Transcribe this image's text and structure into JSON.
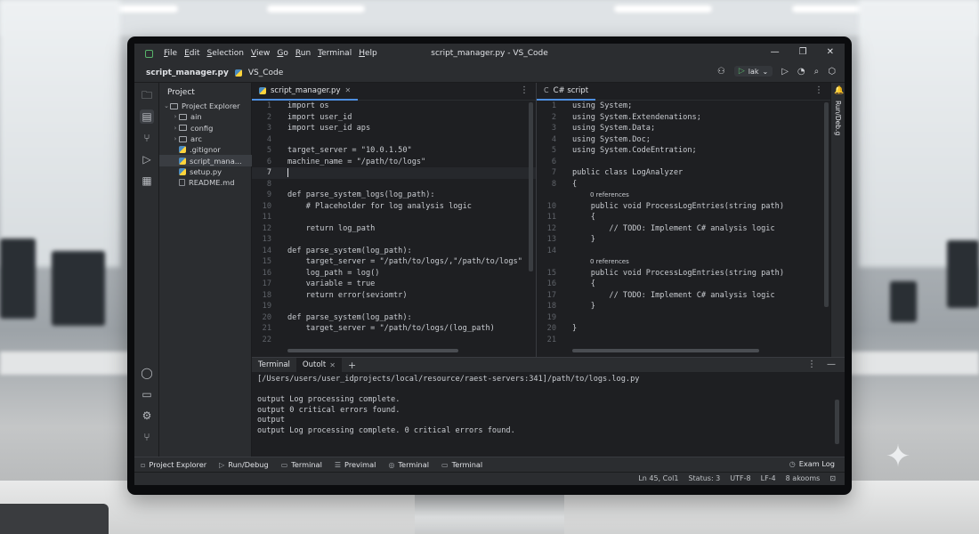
{
  "window": {
    "title": "script_manager.py - VS_Code",
    "menu": [
      "File",
      "Edit",
      "Selection",
      "View",
      "Go",
      "Run",
      "Terminal",
      "Help"
    ],
    "controls": [
      "—",
      "❐",
      "✕"
    ]
  },
  "toolbar": {
    "file": "script_manager.py",
    "project": "VS_Code",
    "run_config": "lak",
    "icons": [
      "account-icon",
      "play-icon",
      "debug-icon",
      "search-icon",
      "settings-icon"
    ]
  },
  "activity_bar": {
    "icons": [
      "folder-icon",
      "explorer-icon",
      "source-control-icon",
      "run-debug-icon",
      "extensions-icon",
      "account-icon",
      "terminal-icon",
      "settings-icon",
      "git-icon"
    ]
  },
  "explorer": {
    "panel_title": "Project",
    "items": [
      {
        "label": "Project Explorer",
        "kind": "folder",
        "expanded": true,
        "depth": 0
      },
      {
        "label": "ain",
        "kind": "folder",
        "expanded": false,
        "depth": 1
      },
      {
        "label": "config",
        "kind": "folder",
        "expanded": false,
        "depth": 1
      },
      {
        "label": "arc",
        "kind": "folder",
        "expanded": false,
        "depth": 1
      },
      {
        "label": ".gitignor",
        "kind": "py",
        "depth": 1
      },
      {
        "label": "script_mana...",
        "kind": "py",
        "depth": 1,
        "selected": true
      },
      {
        "label": "setup.py",
        "kind": "py",
        "depth": 1
      },
      {
        "label": "README.md",
        "kind": "doc",
        "depth": 1
      }
    ]
  },
  "editor_left": {
    "tab": "script_manager.py",
    "current_line": 7,
    "lines": [
      {
        "n": "1",
        "text": "import os"
      },
      {
        "n": "2",
        "text": "import user_id"
      },
      {
        "n": "3",
        "text": "import user_id aps"
      },
      {
        "n": "4",
        "text": ""
      },
      {
        "n": "5",
        "text": "target_server = \"10.0.1.50\""
      },
      {
        "n": "6",
        "text": "machine_name = \"/path/to/logs\""
      },
      {
        "n": "7",
        "text": ""
      },
      {
        "n": "8",
        "text": ""
      },
      {
        "n": "9",
        "text": "def parse_system_logs(log_path):"
      },
      {
        "n": "10",
        "text": "    # Placeholder for log analysis logic"
      },
      {
        "n": "11",
        "text": ""
      },
      {
        "n": "12",
        "text": "    return log_path"
      },
      {
        "n": "13",
        "text": ""
      },
      {
        "n": "14",
        "text": "def parse_system(log_path):"
      },
      {
        "n": "15",
        "text": "    target_server = \"/path/to/logs/,\"/path/to/logs\""
      },
      {
        "n": "16",
        "text": "    log_path = log()"
      },
      {
        "n": "17",
        "text": "    variable = true"
      },
      {
        "n": "18",
        "text": "    return error(seviomtr)"
      },
      {
        "n": "19",
        "text": ""
      },
      {
        "n": "20",
        "text": "def parse_system(log_path):"
      },
      {
        "n": "21",
        "text": "    target_server = \"/path/to/logs/(log_path)"
      },
      {
        "n": "22",
        "text": ""
      }
    ]
  },
  "editor_right": {
    "tab": "C# script",
    "lines": [
      {
        "n": "1",
        "text": "using System;"
      },
      {
        "n": "2",
        "text": "using System.Extendenations;"
      },
      {
        "n": "3",
        "text": "using System.Data;"
      },
      {
        "n": "4",
        "text": "using System.Doc;"
      },
      {
        "n": "5",
        "text": "using System.CodeEntration;"
      },
      {
        "n": "6",
        "text": ""
      },
      {
        "n": "7",
        "text": "public class LogAnalyzer"
      },
      {
        "n": "8",
        "text": "{"
      },
      {
        "hint": "0 references"
      },
      {
        "n": "10",
        "text": "    public void ProcessLogEntries(string path)"
      },
      {
        "n": "11",
        "text": "    {"
      },
      {
        "n": "12",
        "text": "        // TODO: Implement C# analysis logic"
      },
      {
        "n": "13",
        "text": "    }"
      },
      {
        "n": "14",
        "text": ""
      },
      {
        "hint": "0 references"
      },
      {
        "n": "15",
        "text": "    public void ProcessLogEntries(string path)"
      },
      {
        "n": "16",
        "text": "    {"
      },
      {
        "n": "17",
        "text": "        // TODO: Implement C# analysis logic"
      },
      {
        "n": "18",
        "text": "    }"
      },
      {
        "n": "19",
        "text": ""
      },
      {
        "n": "20",
        "text": "}"
      },
      {
        "n": "21",
        "text": ""
      }
    ]
  },
  "terminal": {
    "tabs": [
      "Terminal",
      "Outolt"
    ],
    "active_tab": 1,
    "lines": [
      "[/Users/users/user_idprojects/local/resource/raest-servers:341]/path/to/logs.log.py",
      "",
      "output Log processing complete.",
      "output 0 critical errors found.",
      "output",
      "output Log processing complete. 0 critical errors found."
    ]
  },
  "toolstrip": {
    "items": [
      {
        "label": "Project Explorer",
        "icon": "folder-icon"
      },
      {
        "label": "Run/Debug",
        "icon": "play-icon"
      },
      {
        "label": "Terminal",
        "icon": "terminal-icon"
      },
      {
        "label": "Previmal",
        "icon": "list-icon"
      },
      {
        "label": "Terminal",
        "icon": "target-icon"
      },
      {
        "label": "Terminal",
        "icon": "terminal-icon"
      }
    ],
    "right": "Exam Log"
  },
  "statusbar": {
    "items": [
      "Ln 45, Col1",
      "Status: 3",
      "UTF-8",
      "LF-4",
      "8 akooms"
    ]
  },
  "rail": {
    "label": "Run/Deb.g"
  }
}
